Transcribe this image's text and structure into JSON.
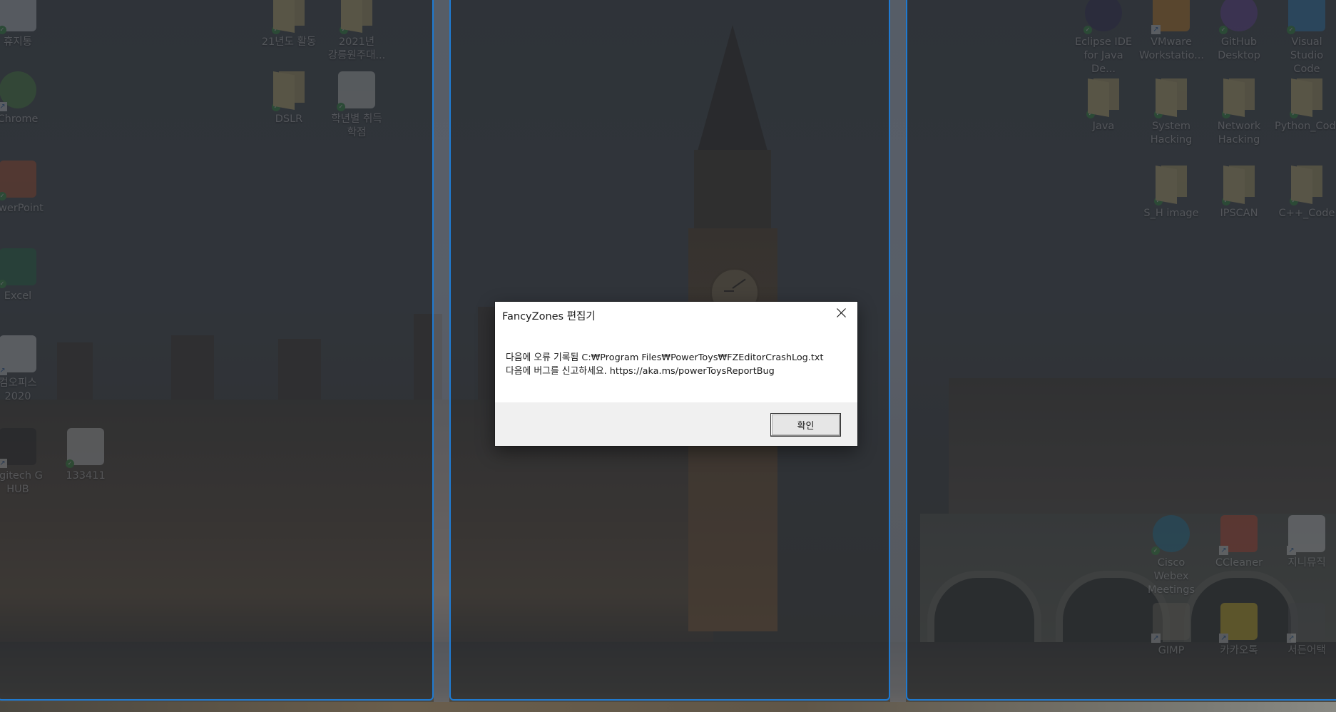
{
  "desktop": {
    "wallpaper": "Palace of Westminster / Big Ben at dusk",
    "icons_left": [
      {
        "label": "휴지통",
        "icon": "recycle-bin-icon"
      },
      {
        "label": "Chrome",
        "icon": "chrome-icon"
      },
      {
        "label": "owerPoint",
        "icon": "powerpoint-icon"
      },
      {
        "label": "Excel",
        "icon": "excel-icon"
      },
      {
        "label": "컴오피스\n2020",
        "icon": "hancom-office-icon"
      },
      {
        "label": "ogitech G\nHUB",
        "icon": "logitech-ghub-icon"
      },
      {
        "label": "133411",
        "icon": "image-file-icon"
      },
      {
        "label": "21년도 활동",
        "icon": "folder-icon"
      },
      {
        "label": "2021년\n강릉원주대...",
        "icon": "folder-icon"
      },
      {
        "label": "DSLR",
        "icon": "folder-icon"
      },
      {
        "label": "학년별 취득\n학점",
        "icon": "excel-file-icon"
      }
    ],
    "icons_right": [
      {
        "label": "Eclipse IDE\nfor Java De...",
        "icon": "eclipse-icon"
      },
      {
        "label": "VMware\nWorkstatio...",
        "icon": "vmware-icon"
      },
      {
        "label": "GitHub\nDesktop",
        "icon": "github-icon"
      },
      {
        "label": "Visual Studio\nCode",
        "icon": "vscode-icon"
      },
      {
        "label": "Java",
        "icon": "folder-icon"
      },
      {
        "label": "System\nHacking",
        "icon": "folder-icon"
      },
      {
        "label": "Network\nHacking",
        "icon": "folder-icon"
      },
      {
        "label": "Python_Code",
        "icon": "folder-icon"
      },
      {
        "label": "S_H image",
        "icon": "folder-icon"
      },
      {
        "label": "IPSCAN",
        "icon": "folder-icon"
      },
      {
        "label": "C++_Code",
        "icon": "folder-icon"
      },
      {
        "label": "Cisco Webex\nMeetings",
        "icon": "webex-icon"
      },
      {
        "label": "CCleaner",
        "icon": "ccleaner-icon"
      },
      {
        "label": "지니뮤직",
        "icon": "genie-music-icon"
      },
      {
        "label": "GIMP",
        "icon": "gimp-icon"
      },
      {
        "label": "카카오톡",
        "icon": "kakaotalk-icon"
      },
      {
        "label": "서든어택",
        "icon": "sudden-attack-icon"
      }
    ]
  },
  "zones": {
    "count": 3,
    "accent": "#1f7ad1"
  },
  "dialog": {
    "title": "FancyZones 편집기",
    "message_line1": "다음에 오류 기록됨 C:₩Program Files₩PowerToys₩FZEditorCrashLog.txt",
    "message_line2": "다음에 버그를 신고하세요. https://aka.ms/powerToysReportBug",
    "ok_label": "확인",
    "close_icon": "close-icon"
  }
}
